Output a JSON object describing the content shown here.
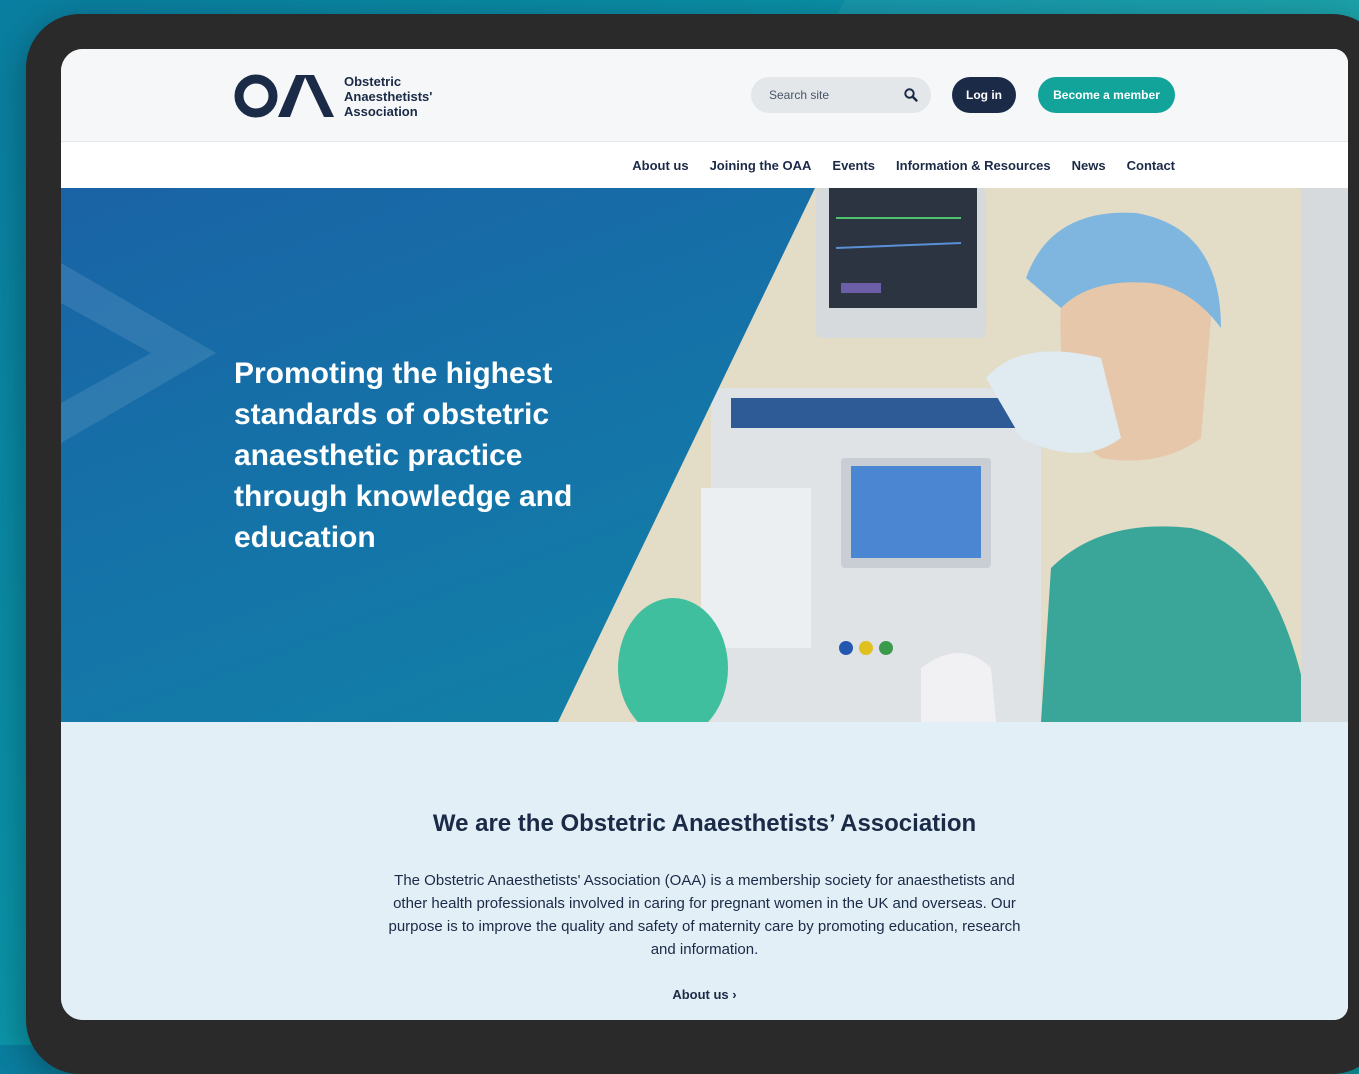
{
  "brand": {
    "logo_line1": "Obstetric",
    "logo_line2": "Anaesthetists'",
    "logo_line3": "Association",
    "navy": "#1b2a47",
    "teal": "#12a39a"
  },
  "header": {
    "search_placeholder": "Search site",
    "login_label": "Log in",
    "member_label": "Become a member"
  },
  "nav": {
    "items": [
      "About us",
      "Joining the OAA",
      "Events",
      "Information & Resources",
      "News",
      "Contact"
    ]
  },
  "hero": {
    "title": "Promoting the highest standards of obstetric anaesthetic practice through knowledge and education"
  },
  "about": {
    "title": "We are the Obstetric Anaesthetists’ Association",
    "body": "The Obstetric Anaesthetists' Association (OAA) is a membership society for anaesthetists and other health professionals involved in caring for pregnant women in the UK and overseas. Our purpose is to improve the quality and safety of maternity care by promoting education, research and information.",
    "link_label": "About us"
  }
}
